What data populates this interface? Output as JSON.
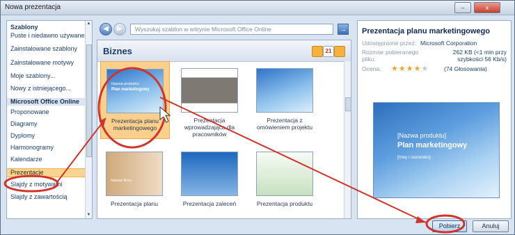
{
  "window": {
    "title": "Nowa prezentacja",
    "minimize": "–",
    "close": "x"
  },
  "left_panel": {
    "items": [
      {
        "label": "Szablony",
        "type": "head"
      },
      {
        "label": "Puste i niedawno używane",
        "type": "item"
      },
      {
        "label": "Zainstalowane szablony",
        "type": "item"
      },
      {
        "label": "Zainstalowane motywy",
        "type": "item"
      },
      {
        "label": "Moje szablony...",
        "type": "item"
      },
      {
        "label": "Nowy z istniejącego...",
        "type": "item"
      },
      {
        "label": "Microsoft Office Online",
        "type": "group"
      },
      {
        "label": "Proponowane",
        "type": "item"
      },
      {
        "label": "Diagramy",
        "type": "item"
      },
      {
        "label": "Dyplomy",
        "type": "item"
      },
      {
        "label": "Harmonogramy",
        "type": "item"
      },
      {
        "label": "Kalendarze",
        "type": "item"
      },
      {
        "label": "Prezentacje",
        "type": "selected"
      },
      {
        "label": "Slajdy z motywami",
        "type": "item"
      },
      {
        "label": "Slajdy z zawartością",
        "type": "item"
      }
    ]
  },
  "toolbar": {
    "back": "◀",
    "forward": "▶",
    "search_placeholder": "Wyszukaj szablon w witrynie Microsoft Office Online",
    "go": "→"
  },
  "gallery": {
    "title": "Biznes",
    "sort_icon": "21",
    "tiles": [
      {
        "caption": "Prezentacja planu marketingowego",
        "thumb": "blue",
        "selected": true,
        "thumb_title": "Nazwa produktu",
        "thumb_sub": "Plan marketingowy"
      },
      {
        "caption": "Prezentacja wprowadzająca dla pracowników",
        "thumb": "photo",
        "selected": false
      },
      {
        "caption": "Prezentacja z omówieniem projektu",
        "thumb": "blue",
        "selected": false
      },
      {
        "caption": "Prezentacja planu",
        "thumb": "warm",
        "selected": false,
        "thumb_title": "Nazwa firmy"
      },
      {
        "caption": "Prezentacja zaleceń",
        "thumb": "blue2",
        "selected": false
      },
      {
        "caption": "Prezentacja produktu",
        "thumb": "green",
        "selected": false
      }
    ]
  },
  "details": {
    "title": "Prezentacja planu marketingowego",
    "provider_label": "Udostępnione przez:",
    "provider_value": "Microsoft Corporation",
    "size_label": "Rozmiar pobieranego pliku:",
    "size_value": "262 KB (<1 min przy szybkości 56 Kb/s)",
    "rating_label": "Ocena:",
    "rating_stars": 4,
    "rating_max": 5,
    "rating_value": "(74 Głosowania)"
  },
  "preview": {
    "name": "[Nazwa produktu]",
    "plan": "Plan marketingowy",
    "sub": "[Imię i nazwisko]"
  },
  "buttons": {
    "download": "Pobierz",
    "cancel": "Anuluj"
  }
}
